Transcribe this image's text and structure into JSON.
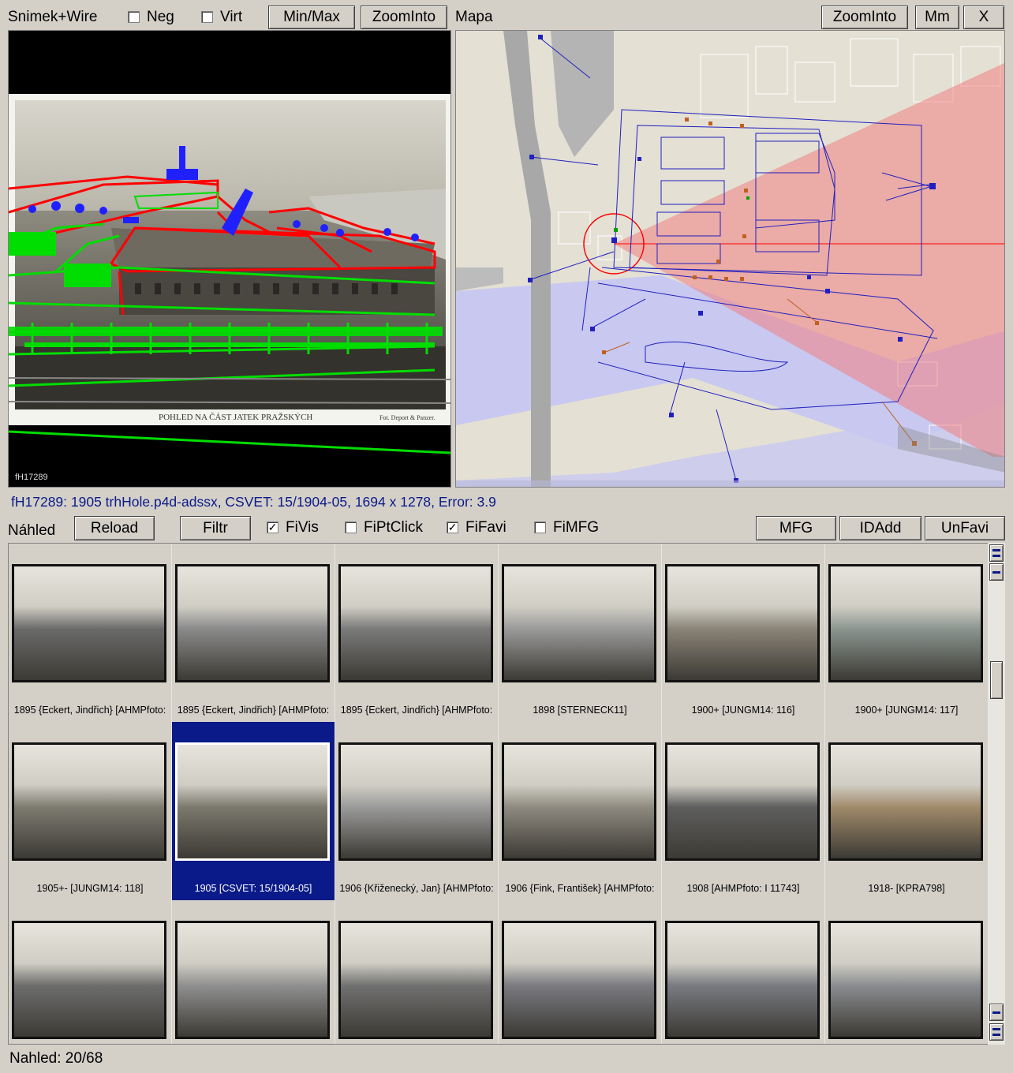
{
  "photo_panel": {
    "title": "Snimek+Wire",
    "neg_label": "Neg",
    "virt_label": "Virt",
    "minmax_label": "Min/Max",
    "zoominto_label": "ZoomInto",
    "photo_caption": "POHLED NA ČÁST JATEK PRAŽSKÝCH",
    "photo_credit": "Fot. Deport & Panzer.",
    "image_id": "fH17289"
  },
  "map_panel": {
    "title": "Mapa",
    "zoominto_label": "ZoomInto",
    "mm_label": "Mm",
    "close_label": "X"
  },
  "info_line": "fH17289: 1905  trhHole.p4d-adssx, CSVET: 15/1904-05, 1694 x 1278, Error: 3.9",
  "nahled_toolbar": {
    "title": "Náhled",
    "reload_label": "Reload",
    "filtr_label": "Filtr",
    "fivis_label": "FiVis",
    "fivis_checked": true,
    "fiptclick_label": "FiPtClick",
    "fiptclick_checked": false,
    "fifavi_label": "FiFavi",
    "fifavi_checked": true,
    "fimfg_label": "FiMFG",
    "fimfg_checked": false,
    "mfg_label": "MFG",
    "idadd_label": "IDAdd",
    "unfavi_label": "UnFavi"
  },
  "thumbnails": [
    {
      "caption": "1895 {Eckert, Jindřich} [AHMPfoto:",
      "tone": "#6a6a6a"
    },
    {
      "caption": "1895 {Eckert, Jindřich} [AHMPfoto:",
      "tone": "#8a8a8a"
    },
    {
      "caption": "1895 {Eckert, Jindřich} [AHMPfoto:",
      "tone": "#7a7a7a"
    },
    {
      "caption": "1898  [STERNECK11]",
      "tone": "#9a9a9a"
    },
    {
      "caption": "1900+  [JUNGM14: 116]",
      "tone": "#8a8478"
    },
    {
      "caption": "1900+  [JUNGM14: 117]",
      "tone": "#8b9590"
    },
    {
      "caption": "1905+-  [JUNGM14: 118]",
      "tone": "#7d7a70"
    },
    {
      "caption": "1905  [CSVET: 15/1904-05]",
      "tone": "#7b786d",
      "selected": true
    },
    {
      "caption": "1906 {Křiženecký, Jan} [AHMPfoto:",
      "tone": "#9a9a9a"
    },
    {
      "caption": "1906 {Fink, František} [AHMPfoto:",
      "tone": "#8e8a80"
    },
    {
      "caption": "1908  [AHMPfoto: I 11743]",
      "tone": "#5e5e5e"
    },
    {
      "caption": "1918-  [KPRA798]",
      "tone": "#a08a6a"
    },
    {
      "caption": "",
      "tone": "#6d6d6d"
    },
    {
      "caption": "",
      "tone": "#8f8f8f"
    },
    {
      "caption": "",
      "tone": "#707070"
    },
    {
      "caption": "",
      "tone": "#7a7a80"
    },
    {
      "caption": "",
      "tone": "#787a80"
    },
    {
      "caption": "",
      "tone": "#8a8c90"
    }
  ],
  "status_bar": "Nahled: 20/68",
  "colors": {
    "selection": "#0a1a88",
    "info_text": "#0a1a88",
    "wire_red": "#ff0000",
    "wire_green": "#00dd00",
    "wire_blue": "#2020ff",
    "map_background": "#e4e0d4",
    "map_view_cone": "#f08080"
  }
}
